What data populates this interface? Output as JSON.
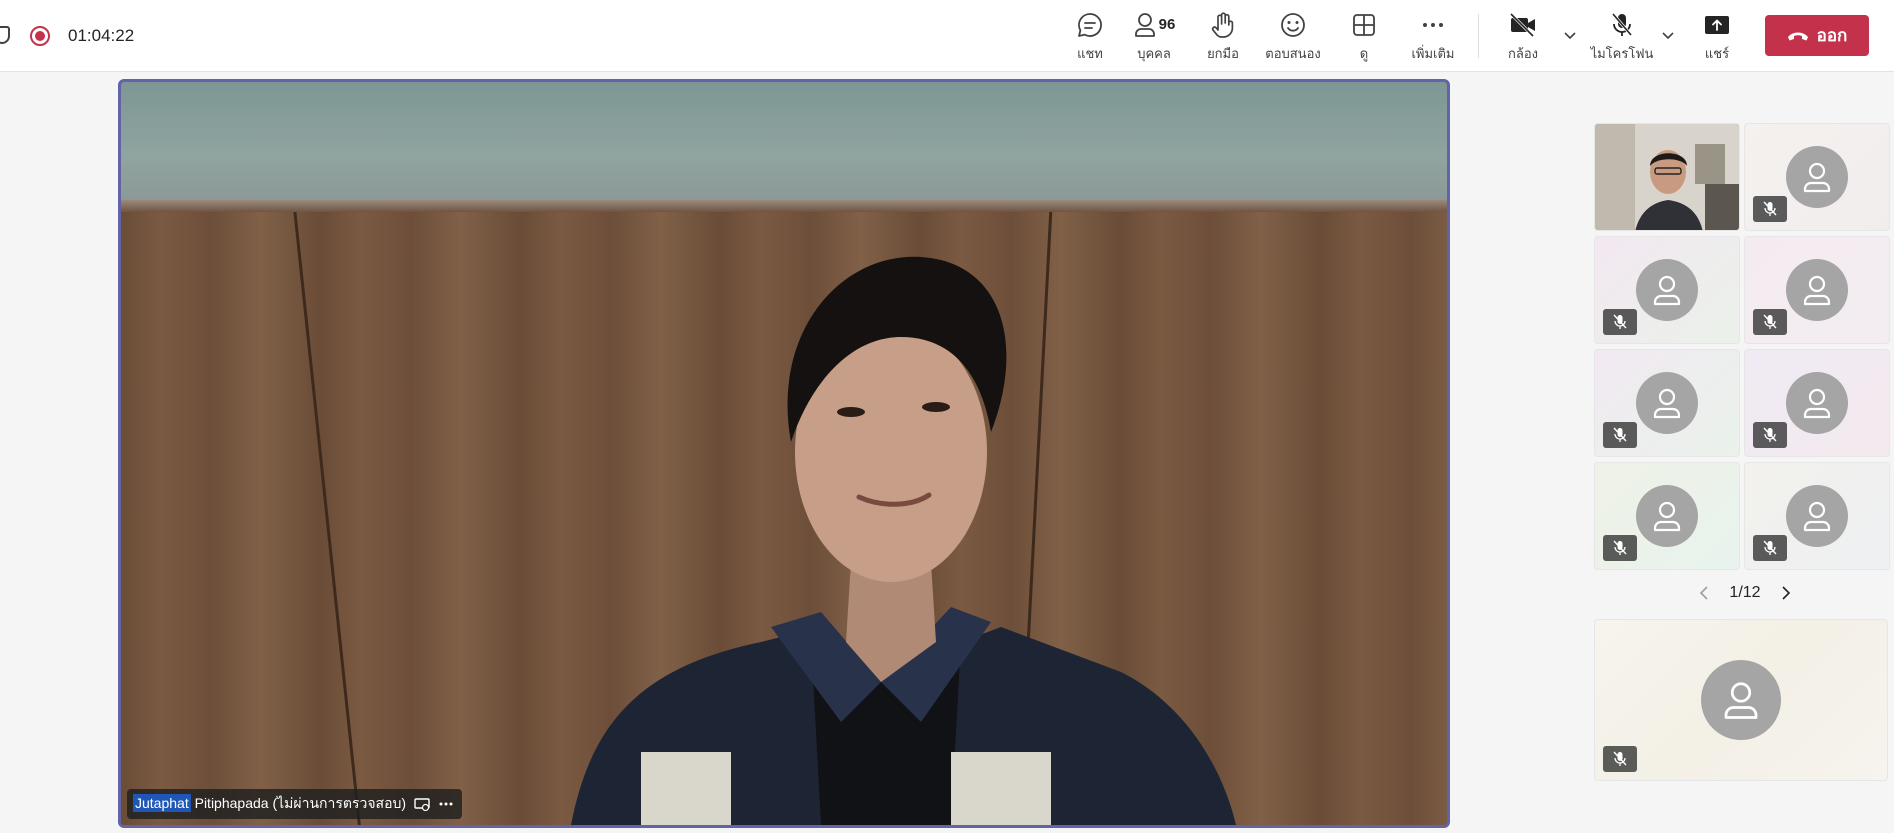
{
  "topbar": {
    "timer": "01:04:22",
    "buttons": {
      "chat": "แชท",
      "people": "บุคคล",
      "people_count": "96",
      "raise_hand": "ยกมือ",
      "react": "ตอบสนอง",
      "view": "ดู",
      "more": "เพิ่มเติม",
      "camera": "กล้อง",
      "mic": "ไมโครโฟน",
      "share": "แชร์"
    },
    "leave_label": "ออก",
    "leave_color": "#c4314b"
  },
  "main_video": {
    "name_highlight": "Jutaphat",
    "name_rest": " Pitiphapada (ไม่ผ่านการตรวจสอบ)",
    "border_color": "#6264a7"
  },
  "gallery": {
    "page": "1/12",
    "tiles": [
      {
        "type": "video",
        "muted": false
      },
      {
        "type": "avatar",
        "muted": true
      },
      {
        "type": "avatar",
        "muted": true
      },
      {
        "type": "avatar",
        "muted": true
      },
      {
        "type": "avatar",
        "muted": true
      },
      {
        "type": "avatar",
        "muted": true
      },
      {
        "type": "avatar",
        "muted": true
      },
      {
        "type": "avatar",
        "muted": true
      }
    ],
    "featured_tile": {
      "type": "avatar",
      "muted": true
    }
  }
}
